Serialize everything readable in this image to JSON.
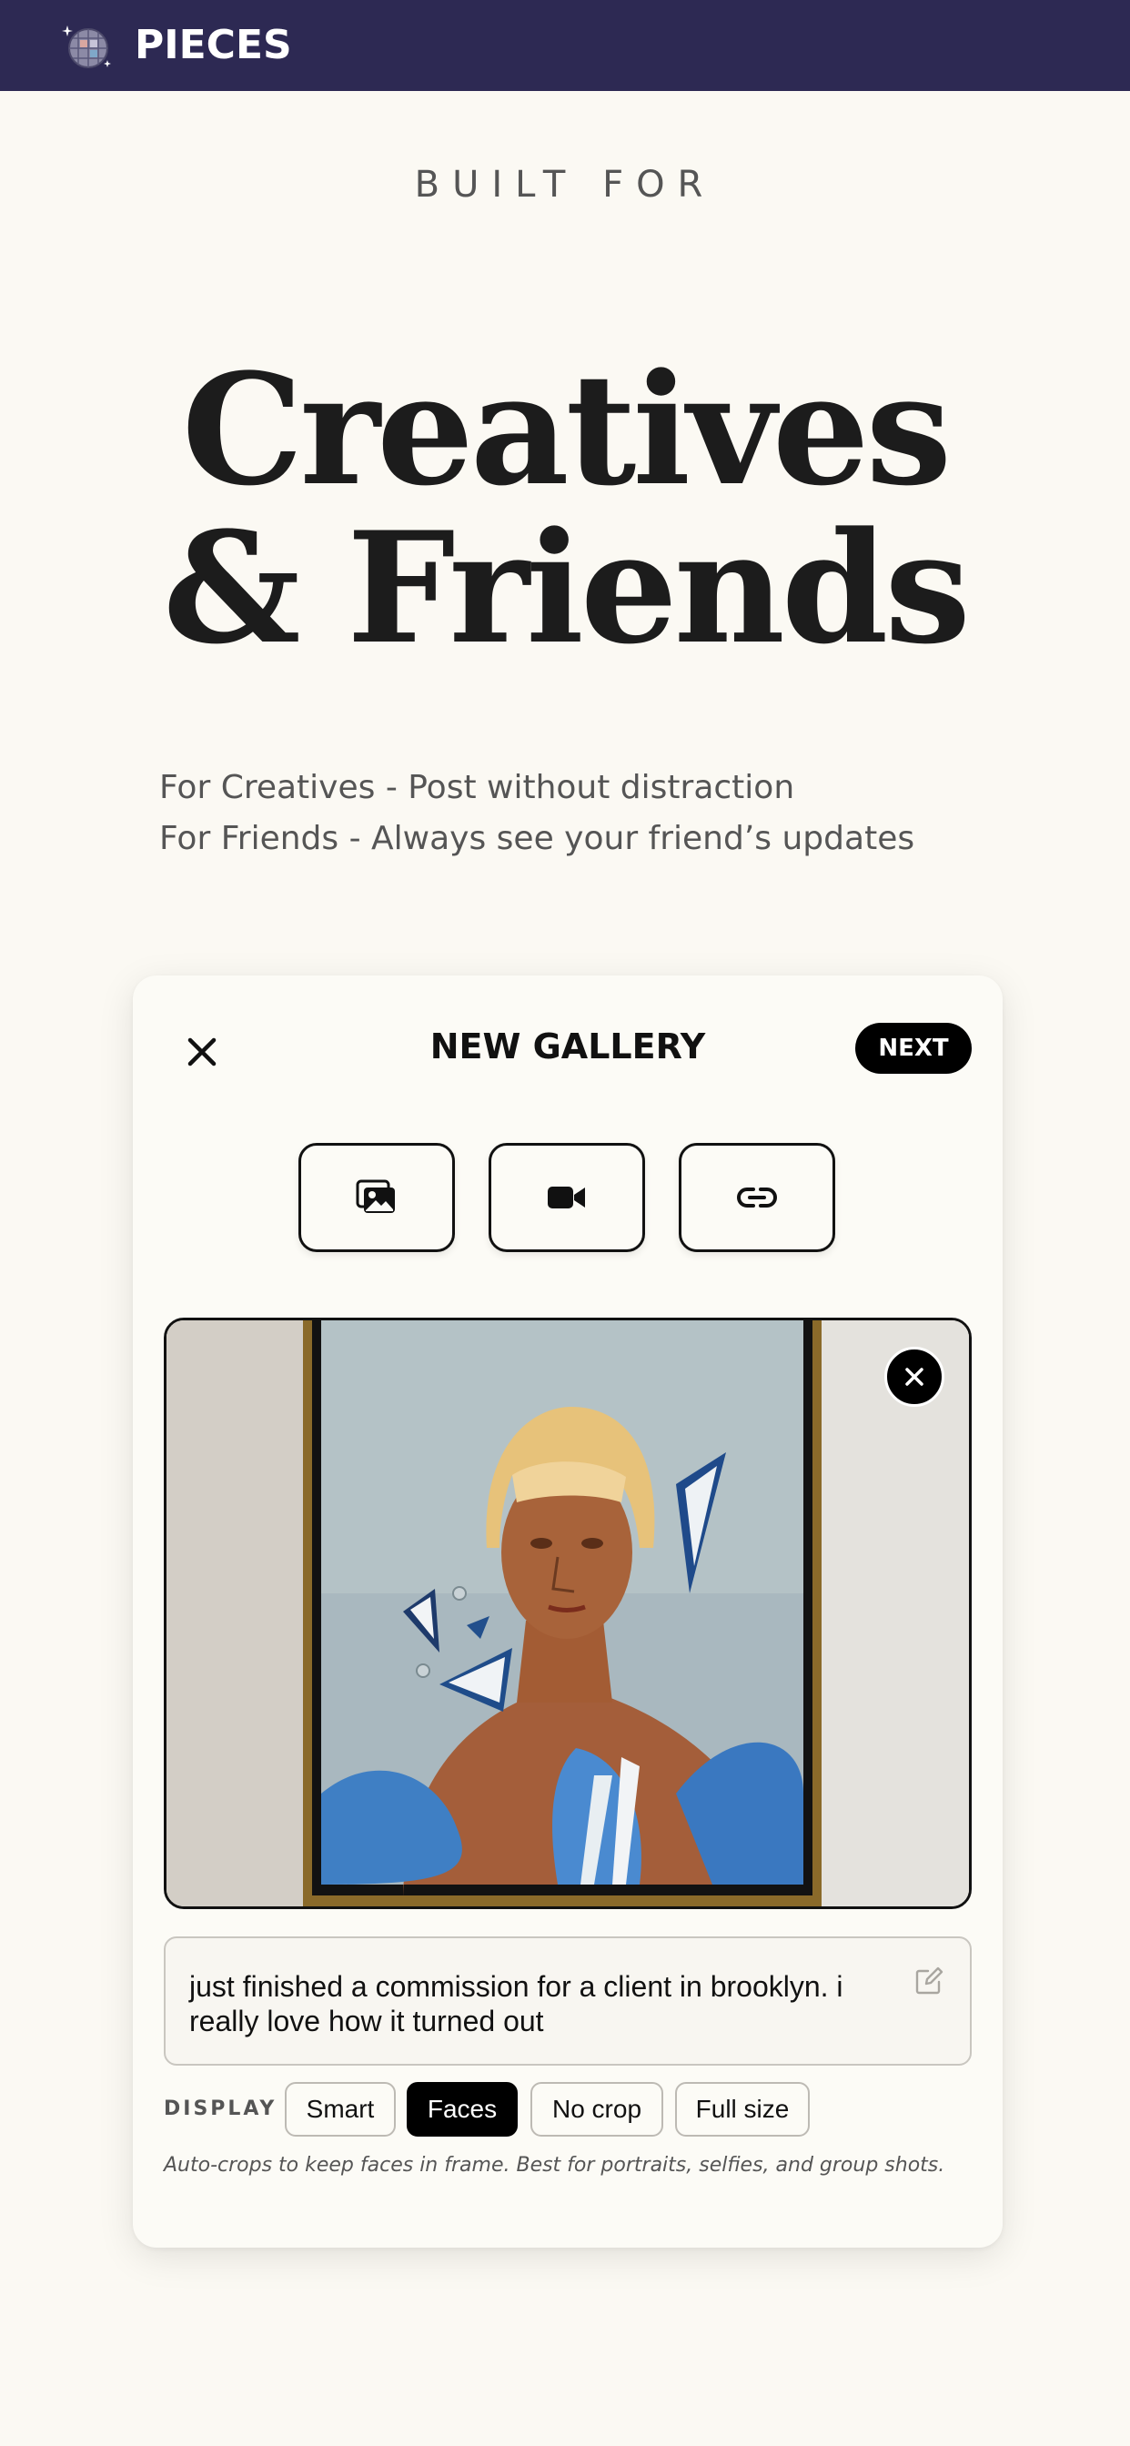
{
  "brand": {
    "name": "PIECES",
    "logo_icon": "disco-ball-icon"
  },
  "hero": {
    "kicker": "BUILT FOR",
    "title_line1": "Creatives",
    "title_line2": "& Friends",
    "tagline_line1": "For Creatives - Post without distraction",
    "tagline_line2": "For Friends - Always see your friend’s updates"
  },
  "composer": {
    "title": "NEW GALLERY",
    "close_icon": "close-icon",
    "next_label": "NEXT",
    "media_buttons": [
      {
        "icon": "image-gallery-icon"
      },
      {
        "icon": "video-camera-icon"
      },
      {
        "icon": "link-icon"
      }
    ],
    "photo": {
      "description_icon": "painting-photo",
      "remove_icon": "close-icon"
    },
    "caption": "just finished a commission for a client in brooklyn. i really love how it turned out",
    "edit_icon": "edit-icon",
    "display": {
      "label": "DISPLAY",
      "options": [
        "Smart",
        "Faces",
        "No crop",
        "Full size"
      ],
      "selected": "Faces",
      "hint": "Auto-crops to keep faces in frame. Best for portraits, selfies, and group shots."
    }
  },
  "colors": {
    "topbar": "#2d2953",
    "background": "#fbf9f3",
    "accent": "#000000"
  }
}
